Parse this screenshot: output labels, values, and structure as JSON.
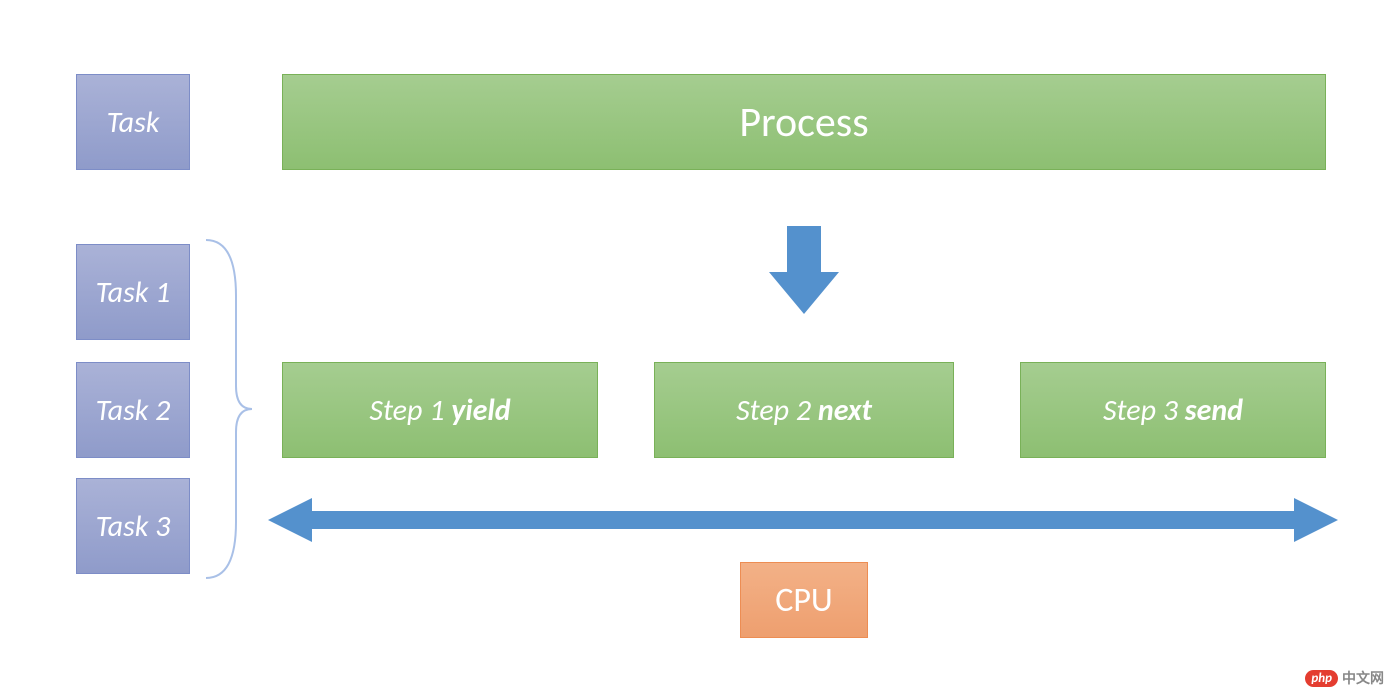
{
  "tasks": {
    "main": "Task",
    "t1": "Task 1",
    "t2": "Task 2",
    "t3": "Task 3"
  },
  "process": "Process",
  "steps": {
    "s1": {
      "prefix": "Step 1 ",
      "emph": "yield"
    },
    "s2": {
      "prefix": "Step 2 ",
      "emph": "next"
    },
    "s3": {
      "prefix": "Step 3 ",
      "emph": "send"
    }
  },
  "cpu": "CPU",
  "watermark": {
    "brand": "php",
    "text": "中文网"
  },
  "colors": {
    "task_fill": "#99a4cf",
    "process_fill": "#97c67e",
    "cpu_fill": "#f0a77a",
    "arrow_fill": "#5491cd",
    "brace_stroke": "#a9c0e7"
  }
}
